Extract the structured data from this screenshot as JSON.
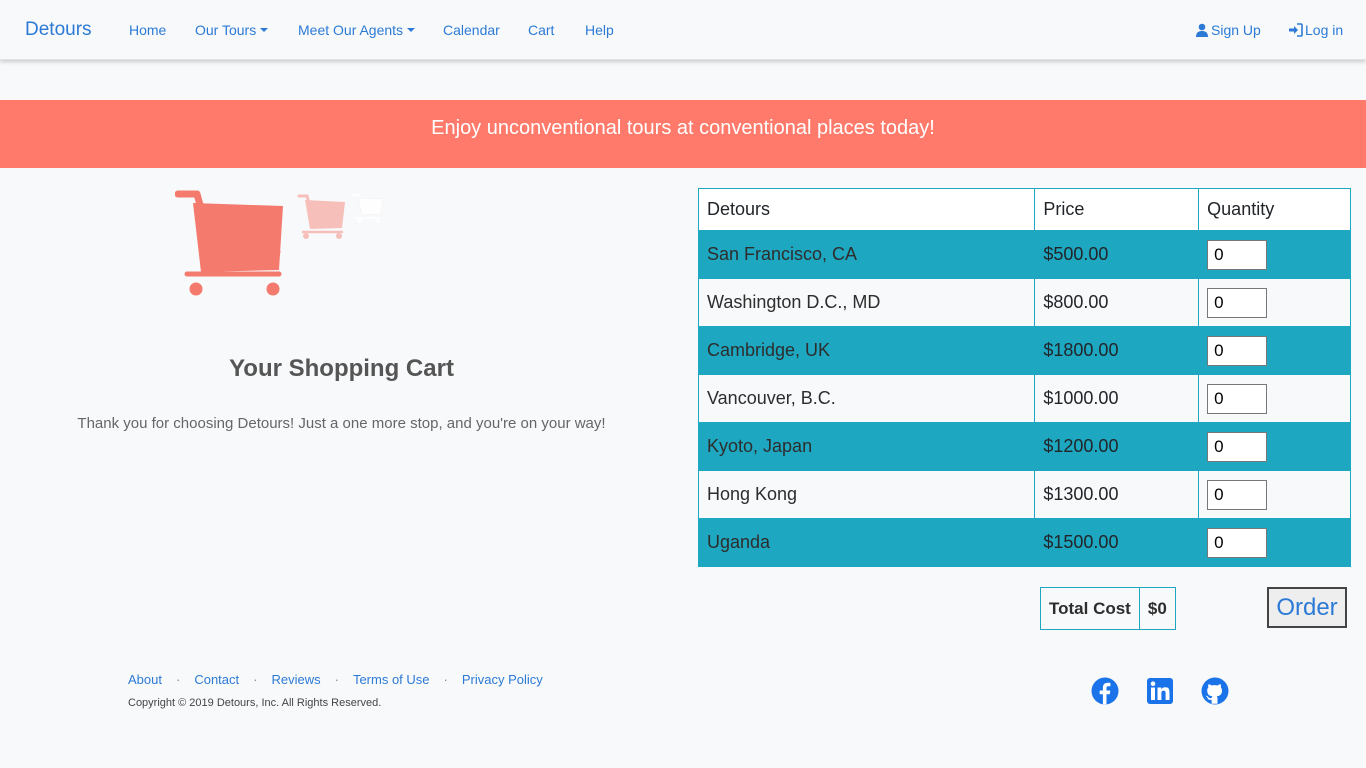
{
  "navbar": {
    "brand": "Detours",
    "links": [
      "Home",
      "Our Tours",
      "Meet Our Agents",
      "Calendar",
      "Cart",
      "Help"
    ],
    "signup": "Sign Up",
    "login": "Log in"
  },
  "banner": {
    "text": "Enjoy unconventional tours at conventional places today!"
  },
  "cart": {
    "title": "Your Shopping Cart",
    "subtitle": "Thank you for choosing Detours! Just a one more stop, and you're on your way!"
  },
  "table": {
    "headers": [
      "Detours",
      "Price",
      "Quantity"
    ],
    "rows": [
      {
        "name": "San Francisco, CA",
        "price": "$500.00",
        "qty": "0"
      },
      {
        "name": "Washington D.C., MD",
        "price": "$800.00",
        "qty": "0"
      },
      {
        "name": "Cambridge, UK",
        "price": "$1800.00",
        "qty": "0"
      },
      {
        "name": "Vancouver, B.C.",
        "price": "$1000.00",
        "qty": "0"
      },
      {
        "name": "Kyoto, Japan",
        "price": "$1200.00",
        "qty": "0"
      },
      {
        "name": "Hong Kong",
        "price": "$1300.00",
        "qty": "0"
      },
      {
        "name": "Uganda",
        "price": "$1500.00",
        "qty": "0"
      }
    ]
  },
  "total": {
    "label": "Total Cost",
    "value": "$0"
  },
  "order_label": "Order",
  "footer": {
    "links": [
      "About",
      "Contact",
      "Reviews",
      "Terms of Use",
      "Privacy Policy"
    ],
    "separator": "·",
    "copyright": "Copyright © 2019 Detours, Inc. All Rights Reserved."
  },
  "social": [
    "facebook-icon",
    "linkedin-icon",
    "github-icon"
  ],
  "colors": {
    "accent": "#2c7ad6",
    "banner": "#ff7a6b",
    "teal": "#1ea7c0",
    "cart": "#f47a6e"
  }
}
